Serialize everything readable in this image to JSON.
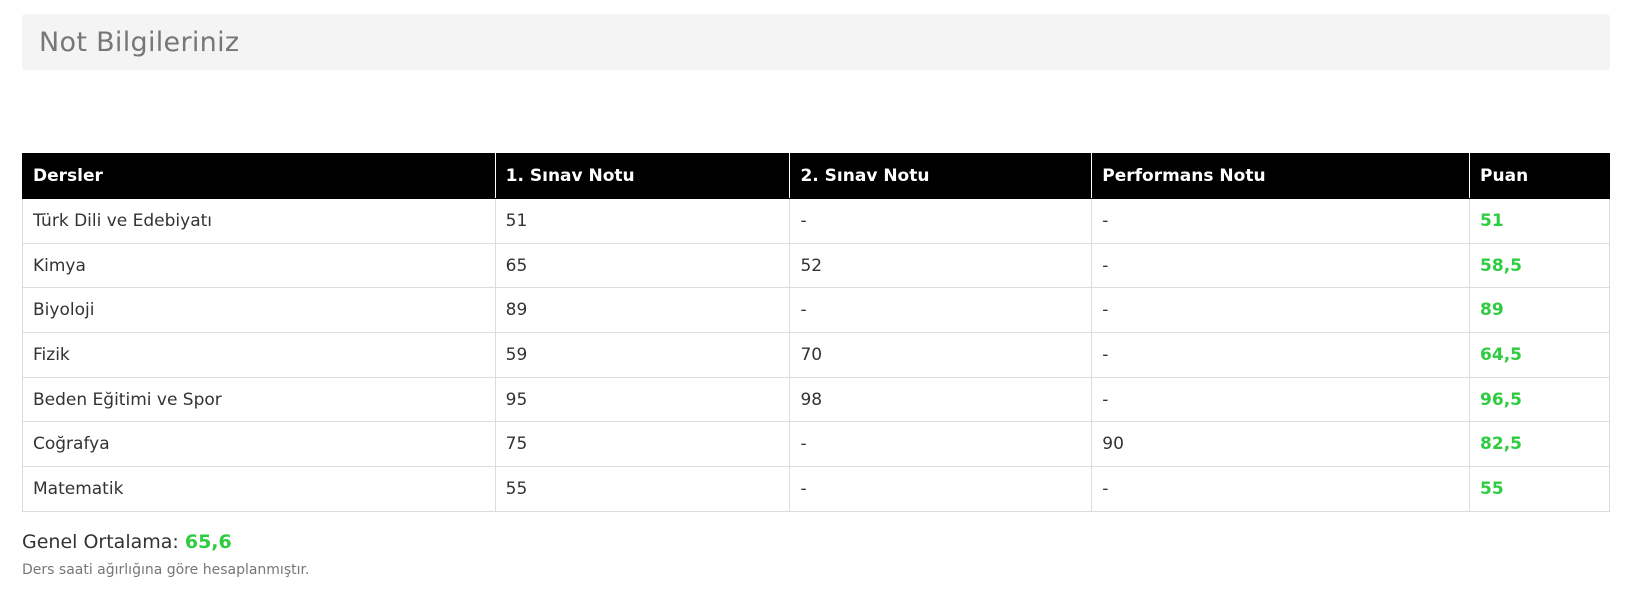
{
  "page": {
    "title": "Not Bilgileriniz"
  },
  "table": {
    "headers": [
      "Dersler",
      "1. Sınav Notu",
      "2. Sınav Notu",
      "Performans Notu",
      "Puan"
    ],
    "rows": [
      [
        "Türk Dili ve Edebiyatı",
        "51",
        "-",
        "-",
        "51"
      ],
      [
        "Kimya",
        "65",
        "52",
        "-",
        "58,5"
      ],
      [
        "Biyoloji",
        "89",
        "-",
        "-",
        "89"
      ],
      [
        "Fizik",
        "59",
        "70",
        "-",
        "64,5"
      ],
      [
        "Beden Eğitimi ve Spor",
        "95",
        "98",
        "-",
        "96,5"
      ],
      [
        "Coğrafya",
        "75",
        "-",
        "90",
        "82,5"
      ],
      [
        "Matematik",
        "55",
        "-",
        "-",
        "55"
      ]
    ]
  },
  "summary": {
    "label": "Genel Ortalama:",
    "value": "65,6",
    "note": "Ders saati ağırlığına göre hesaplanmıştır."
  },
  "colors": {
    "header_bg": "#000000",
    "score_green": "#2ecc40",
    "title_bar_bg": "#f4f4f4"
  }
}
